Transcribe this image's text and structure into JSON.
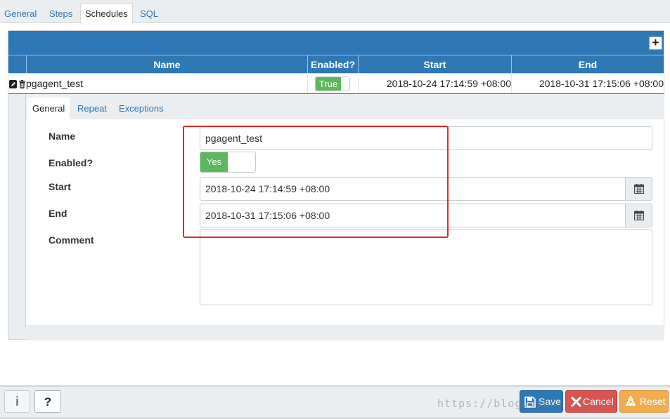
{
  "top_tabs": [
    "General",
    "Steps",
    "Schedules",
    "SQL"
  ],
  "active_top_tab": "Schedules",
  "grid": {
    "columns": [
      "Name",
      "Enabled?",
      "Start",
      "End"
    ],
    "row": {
      "name": "pgagent_test",
      "enabled": "True",
      "start": "2018-10-24 17:14:59 +08:00",
      "end": "2018-10-31 17:15:06 +08:00"
    }
  },
  "detail": {
    "tabs": [
      "General",
      "Repeat",
      "Exceptions"
    ],
    "active_tab": "General",
    "fields": {
      "name_label": "Name",
      "name_value": "pgagent_test",
      "enabled_label": "Enabled?",
      "enabled_value": "Yes",
      "start_label": "Start",
      "start_value": "2018-10-24 17:14:59 +08:00",
      "end_label": "End",
      "end_value": "2018-10-31 17:15:06 +08:00",
      "comment_label": "Comment",
      "comment_value": ""
    }
  },
  "footer": {
    "info_label": "i",
    "help_label": "?",
    "save_label": "Save",
    "cancel_label": "Cancel",
    "reset_label": "Reset"
  },
  "watermark": "https://blog.csdn.net/wff",
  "colors": {
    "header_blue": "#2e78b6",
    "toggle_green": "#5cb85c",
    "cancel_red": "#d9534f",
    "reset_orange": "#f0ad4e",
    "highlight_red": "#e02a1f"
  },
  "icons": {
    "edit": "edit-icon",
    "delete": "trash-icon",
    "add": "plus-icon",
    "calendar": "calendar-icon",
    "save": "floppy-icon",
    "cancel": "x-icon",
    "reset": "recycle-icon"
  }
}
